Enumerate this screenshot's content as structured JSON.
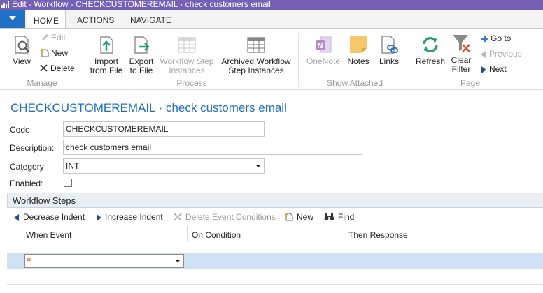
{
  "window": {
    "title": "Edit - Workflow - CHECKCUSTOMEREMAIL · check customers email"
  },
  "ribbon_tabs": [
    {
      "label": "HOME",
      "active": true
    },
    {
      "label": "ACTIONS",
      "active": false
    },
    {
      "label": "NAVIGATE",
      "active": false
    }
  ],
  "ribbon": {
    "manage": {
      "group_label": "Manage",
      "view": "View",
      "edit": "Edit",
      "new": "New",
      "delete": "Delete"
    },
    "process": {
      "group_label": "Process",
      "import_line1": "Import",
      "import_line2": "from File",
      "export_line1": "Export",
      "export_line2": "to File",
      "step_instances_line1": "Workflow Step",
      "step_instances_line2": "Instances",
      "archived_line1": "Archived Workflow",
      "archived_line2": "Step Instances"
    },
    "show_attached": {
      "group_label": "Show Attached",
      "onenote": "OneNote",
      "notes": "Notes",
      "links": "Links"
    },
    "page": {
      "group_label": "Page",
      "refresh": "Refresh",
      "clear_filter_line1": "Clear",
      "clear_filter_line2": "Filter",
      "go_to": "Go to",
      "previous": "Previous",
      "next": "Next"
    }
  },
  "page_title": "CHECKCUSTOMEREMAIL · check customers email",
  "form": {
    "code_label": "Code:",
    "code_value": "CHECKCUSTOMEREMAIL",
    "description_label": "Description:",
    "description_value": "check customers email",
    "category_label": "Category:",
    "category_value": "INT",
    "enabled_label": "Enabled:",
    "enabled_checked": false
  },
  "workflow_steps": {
    "title": "Workflow Steps",
    "toolbar": {
      "decrease_indent": "Decrease Indent",
      "increase_indent": "Increase Indent",
      "delete_event_conditions": "Delete Event Conditions",
      "new": "New",
      "find": "Find"
    },
    "columns": [
      "When Event",
      "On Condition",
      "Then Response"
    ],
    "new_row_marker": "*"
  },
  "colors": {
    "title_bar": "#7560b7",
    "accent_blue": "#1f72c4",
    "page_title": "#1f6fbf",
    "selected_row": "#cfe2f3"
  }
}
